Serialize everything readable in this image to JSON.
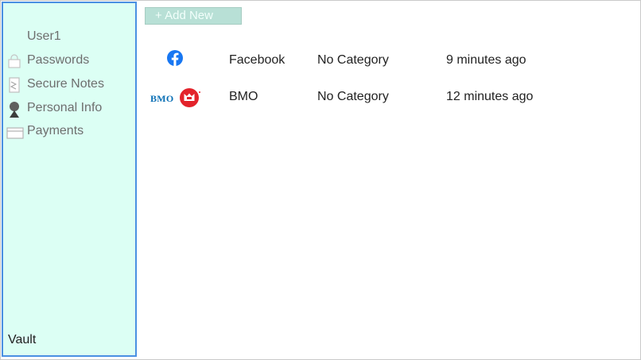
{
  "sidebar": {
    "user": "User1",
    "items": [
      {
        "label": "Passwords",
        "icon": "lock-box-icon"
      },
      {
        "label": "Secure Notes",
        "icon": "note-icon"
      },
      {
        "label": "Personal Info",
        "icon": "person-icon"
      },
      {
        "label": "Payments",
        "icon": "card-icon"
      }
    ],
    "footer": "Vault"
  },
  "toolbar": {
    "add_new_label": "+ Add New"
  },
  "entries": [
    {
      "name": "Facebook",
      "category": "No Category",
      "time": "9 minutes ago",
      "icon": "facebook-icon"
    },
    {
      "name": "BMO",
      "category": "No Category",
      "time": "12 minutes ago",
      "icon": "bmo-logo",
      "logo_text": "BMO"
    }
  ],
  "colors": {
    "sidebar_bg": "#dcfff4",
    "sidebar_border": "#4a90e2",
    "add_button_bg": "#b8e0d6",
    "facebook_blue": "#1877f2",
    "bmo_red": "#e3232b",
    "bmo_blue": "#0a6fb5"
  }
}
